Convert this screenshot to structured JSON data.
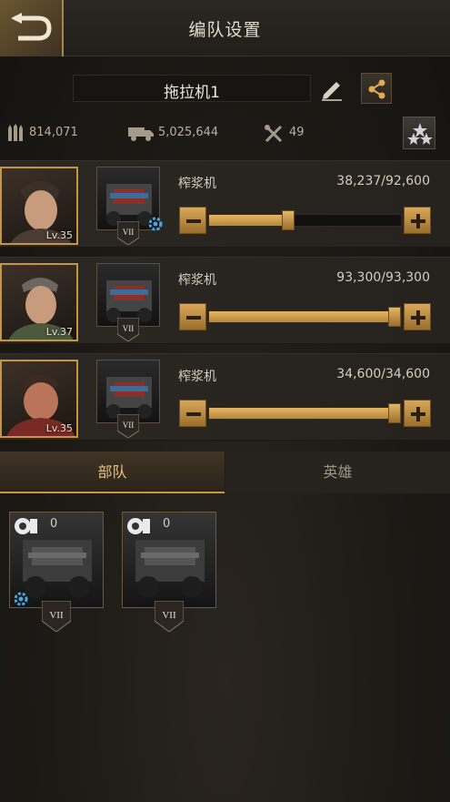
{
  "header": {
    "title": "编队设置",
    "back_icon": "back-arrow-icon"
  },
  "formation": {
    "name": "拖拉机1",
    "edit_icon": "pencil-icon",
    "share_icon": "share-icon"
  },
  "stats": {
    "ammo": "814,071",
    "transport": "5,025,644",
    "tools": "49",
    "rank_icon": "stars-icon"
  },
  "troops": [
    {
      "hero_level": "Lv.35",
      "unit_name": "榨浆机",
      "count": "38,237/92,600",
      "tier": "VII",
      "fill": 0.413,
      "gear": true
    },
    {
      "hero_level": "Lv.37",
      "unit_name": "榨浆机",
      "count": "93,300/93,300",
      "tier": "VII",
      "fill": 1.0,
      "gear": false
    },
    {
      "hero_level": "Lv.35",
      "unit_name": "榨浆机",
      "count": "34,600/34,600",
      "tier": "VII",
      "fill": 1.0,
      "gear": false
    }
  ],
  "tabs": [
    {
      "label": "部队",
      "active": true
    },
    {
      "label": "英雄",
      "active": false
    }
  ],
  "reserve": [
    {
      "qty": "0",
      "tier": "VII",
      "gear": true
    },
    {
      "qty": "0",
      "tier": "VII",
      "gear": false
    }
  ],
  "colors": {
    "accent": "#c9963c",
    "slider_fill": "#e2b566",
    "background": "#1b1815"
  }
}
